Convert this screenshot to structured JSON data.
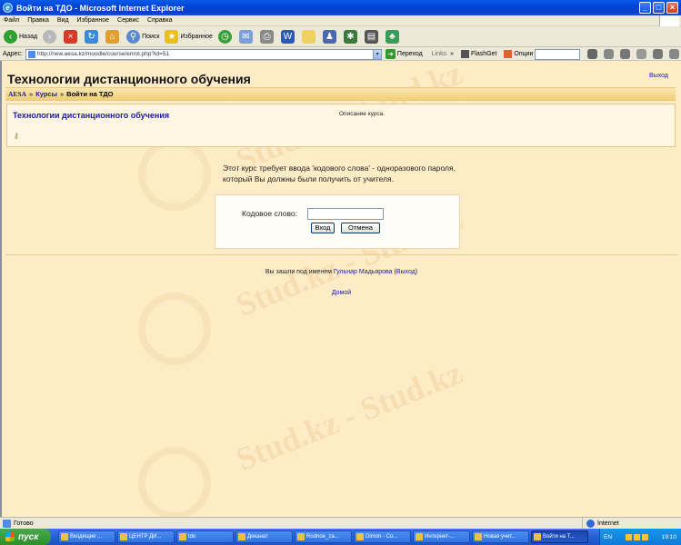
{
  "window": {
    "title": "Войти на ТДО - Microsoft Internet Explorer"
  },
  "menu": [
    "Файл",
    "Правка",
    "Вид",
    "Избранное",
    "Сервис",
    "Справка"
  ],
  "toolbar": {
    "back": "Назад",
    "search": "Поиск",
    "favorites": "Избранное"
  },
  "address": {
    "label": "Адрес:",
    "url": "http://new.aesa.kz/moodle/course/enrol.php?id=51",
    "go": "Переход",
    "links": "Links",
    "flashget": "FlashGet",
    "options": "Опции"
  },
  "page": {
    "header": "Технологии дистанционного обучения",
    "logout_top": "Выход",
    "breadcrumb": {
      "home": "AESA",
      "courses": "Курсы",
      "current": "Войти на ТДО"
    },
    "course": {
      "name": "Технологии дистанционного обучения",
      "description": "Описание курса."
    },
    "message": "Этот курс требует ввода 'кодового слова' - одноразового пароля, который Вы должны были получить от учителя.",
    "enrol": {
      "label": "Кодовое слово:",
      "submit": "Вход",
      "cancel": "Отмена"
    },
    "footer": {
      "logged_in_prefix": "Вы зашли под именем",
      "user": "Гульнар Мадьярова",
      "logout": "Выход",
      "home": "Домой"
    }
  },
  "watermark": "Stud.kz - Stud.kz",
  "statusbar": {
    "status": "Готово",
    "zone": "Internet"
  },
  "taskbar": {
    "start": "пуск",
    "tasks": [
      "Входящие ...",
      "ЦЕНТР ДИ...",
      "tdo",
      "Деканат",
      "Rodnoe_za...",
      "Dimon - Co...",
      "Интернет-...",
      "Новая учет...",
      "Войти на Т..."
    ],
    "lang": "EN",
    "time": "19:10"
  }
}
